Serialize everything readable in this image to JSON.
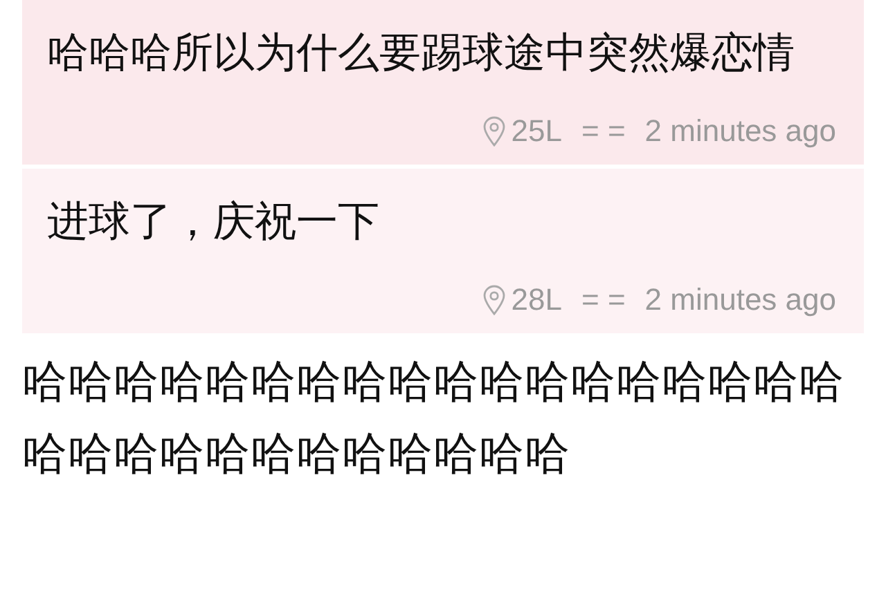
{
  "comments": [
    {
      "text": "哈哈哈所以为什么要踢球途中突然爆恋情",
      "floor": "25L",
      "separator": "= =",
      "time": "2 minutes ago",
      "color": "#fbe9ec"
    },
    {
      "text": "进球了，庆祝一下",
      "floor": "28L",
      "separator": "= =",
      "time": "2 minutes ago",
      "color": "#fdf2f4"
    }
  ],
  "caption": "哈哈哈哈哈哈哈哈哈哈哈哈哈哈哈哈哈哈哈哈哈哈哈哈哈哈哈哈哈哈"
}
